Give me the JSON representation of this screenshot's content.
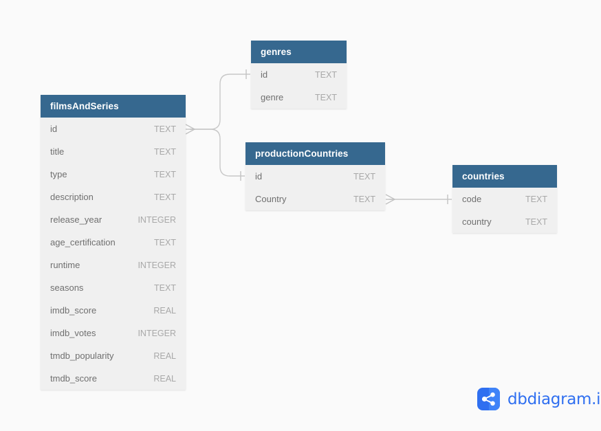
{
  "diagram": {
    "background_color": "#fafafa",
    "header_color": "#36688f",
    "row_color": "#f0f0f0",
    "connector_color": "#c8c8c8"
  },
  "tables": [
    {
      "key": "filmsAndSeries",
      "name": "filmsAndSeries",
      "fields": [
        {
          "name": "id",
          "type": "TEXT"
        },
        {
          "name": "title",
          "type": "TEXT"
        },
        {
          "name": "type",
          "type": "TEXT"
        },
        {
          "name": "description",
          "type": "TEXT"
        },
        {
          "name": "release_year",
          "type": "INTEGER"
        },
        {
          "name": "age_certification",
          "type": "TEXT"
        },
        {
          "name": "runtime",
          "type": "INTEGER"
        },
        {
          "name": "seasons",
          "type": "TEXT"
        },
        {
          "name": "imdb_score",
          "type": "REAL"
        },
        {
          "name": "imdb_votes",
          "type": "INTEGER"
        },
        {
          "name": "tmdb_popularity",
          "type": "REAL"
        },
        {
          "name": "tmdb_score",
          "type": "REAL"
        }
      ]
    },
    {
      "key": "genres",
      "name": "genres",
      "fields": [
        {
          "name": "id",
          "type": "TEXT"
        },
        {
          "name": "genre",
          "type": "TEXT"
        }
      ]
    },
    {
      "key": "productionCountries",
      "name": "productionCountries",
      "fields": [
        {
          "name": "id",
          "type": "TEXT"
        },
        {
          "name": "Country",
          "type": "TEXT"
        }
      ]
    },
    {
      "key": "countries",
      "name": "countries",
      "fields": [
        {
          "name": "code",
          "type": "TEXT"
        },
        {
          "name": "country",
          "type": "TEXT"
        }
      ]
    }
  ],
  "relationships": [
    {
      "from_table": "filmsAndSeries",
      "from_field": "id",
      "to_table": "genres",
      "to_field": "id",
      "from_marker": "crow-foot",
      "to_marker": "one-tick"
    },
    {
      "from_table": "filmsAndSeries",
      "from_field": "id",
      "to_table": "productionCountries",
      "to_field": "id",
      "from_marker": "crow-foot",
      "to_marker": "one-tick"
    },
    {
      "from_table": "productionCountries",
      "from_field": "Country",
      "to_table": "countries",
      "to_field": "code",
      "from_marker": "crow-foot",
      "to_marker": "one-tick"
    }
  ],
  "brand": {
    "name": "dbdiagram.io",
    "icon": "share-nodes-icon",
    "color": "#2f6ff0"
  }
}
